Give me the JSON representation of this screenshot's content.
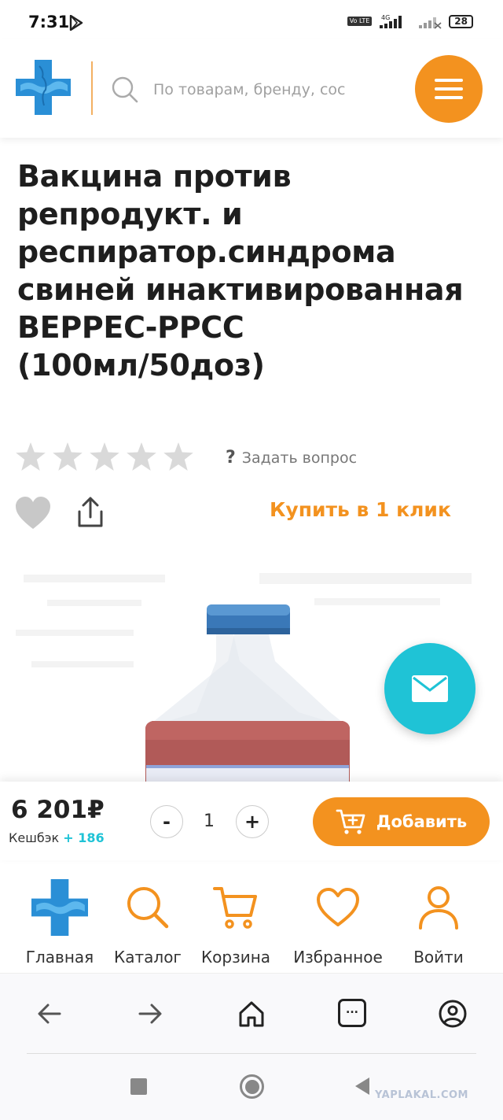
{
  "status_bar": {
    "time": "7:31",
    "network": "4G",
    "volte": "Vo LTE",
    "battery": "28"
  },
  "header": {
    "search_placeholder": "По товарам, бренду, сос",
    "menu_icon": "hamburger-icon",
    "brand_color": "#f3921f",
    "logo_color": "#2a8fd6"
  },
  "product": {
    "title": "Вакцина против репродукт. и респиратор.синдрома свиней инактивированная ВЕРРЕС-РРСС (100мл/50доз)",
    "rating_stars": 0,
    "ask_question_label": "Задать вопрос",
    "buy_one_click_label": "Купить в 1 клик",
    "price": "6 201₽",
    "cashback_label": "Кешбэк",
    "cashback_value": "+ 186",
    "quantity": "1",
    "add_button_label": "Добавить",
    "accent_color": "#1fc3d6"
  },
  "bottom_nav": {
    "items": [
      {
        "label": "Главная",
        "icon": "logo-cross-icon"
      },
      {
        "label": "Каталог",
        "icon": "search-icon"
      },
      {
        "label": "Корзина",
        "icon": "cart-icon"
      },
      {
        "label": "Избранное",
        "icon": "heart-icon"
      },
      {
        "label": "Войти",
        "icon": "user-icon"
      }
    ]
  },
  "browser_bar": {
    "icons": [
      "back-arrow-icon",
      "forward-arrow-icon",
      "home-icon",
      "tabs-icon",
      "profile-icon"
    ],
    "tabs_label": "..."
  },
  "watermark": "YAPLAKAL.COM"
}
